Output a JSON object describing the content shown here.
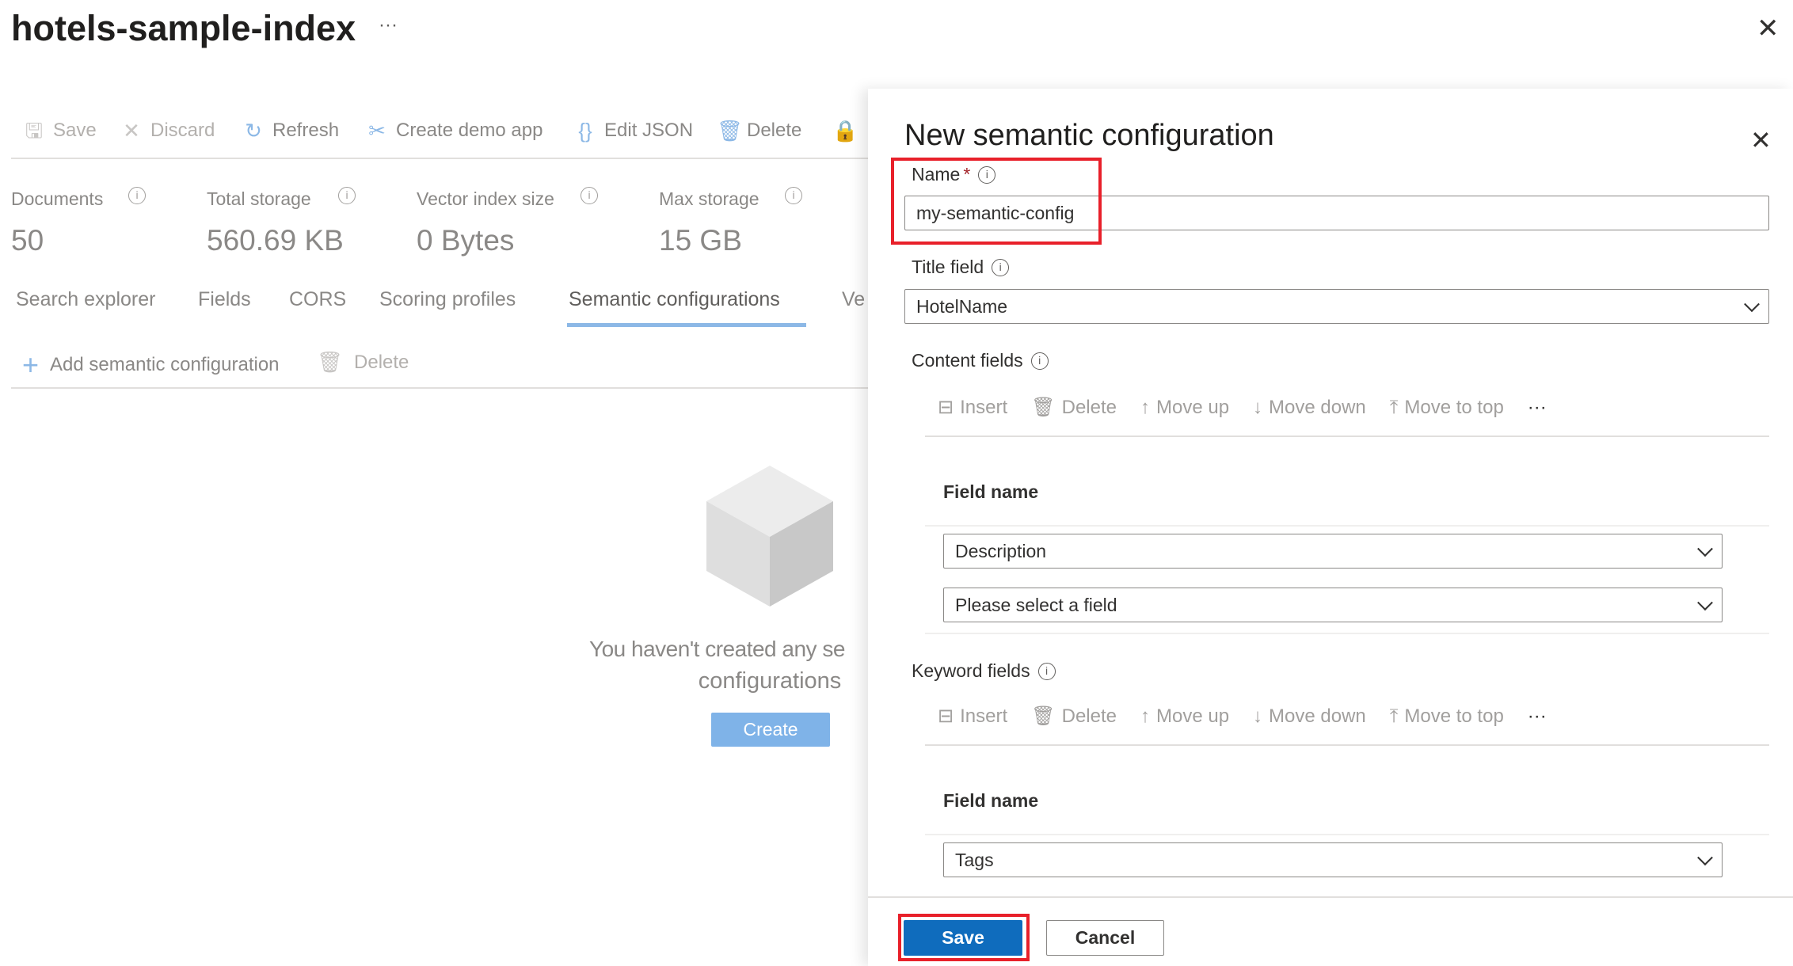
{
  "header": {
    "title": "hotels-sample-index",
    "more": "···",
    "close": "✕"
  },
  "toolbar": [
    {
      "label": "Save",
      "icon": "save-icon"
    },
    {
      "label": "Discard",
      "icon": "discard-icon"
    },
    {
      "label": "Refresh",
      "icon": "refresh-icon"
    },
    {
      "label": "Create demo app",
      "icon": "create-demo-app-icon"
    },
    {
      "label": "Edit JSON",
      "icon": "braces-icon"
    },
    {
      "label": "Delete",
      "icon": "trash-icon"
    }
  ],
  "stats": [
    {
      "label": "Documents",
      "value": "50"
    },
    {
      "label": "Total storage",
      "value": "560.69 KB"
    },
    {
      "label": "Vector index size",
      "value": "0 Bytes"
    },
    {
      "label": "Max storage",
      "value": "15 GB"
    }
  ],
  "tabs": [
    "Search explorer",
    "Fields",
    "CORS",
    "Scoring profiles",
    "Semantic configurations",
    "Ve"
  ],
  "active_tab": "Semantic configurations",
  "subtoolbar": {
    "add": "Add semantic configuration",
    "delete": "Delete"
  },
  "empty": {
    "line1": "You haven't created any se",
    "line2": "configurations",
    "create": "Create"
  },
  "panel": {
    "title": "New semantic configuration",
    "close": "✕",
    "name_label": "Name",
    "required": "*",
    "name_value": "my-semantic-config",
    "title_field_label": "Title field",
    "title_field_value": "HotelName",
    "content_label": "Content fields",
    "keyword_label": "Keyword fields",
    "field_toolbar": [
      "Insert",
      "Delete",
      "Move up",
      "Move down",
      "Move to top"
    ],
    "field_more": "···",
    "field_name_header": "Field name",
    "content_fields": [
      "Description",
      "Please select a field"
    ],
    "keyword_fields": [
      "Tags"
    ],
    "save": "Save",
    "cancel": "Cancel"
  },
  "colors": {
    "accent": "#0f6cbd",
    "highlight": "#e8202a",
    "tab_underline": "#8cb8e6"
  }
}
